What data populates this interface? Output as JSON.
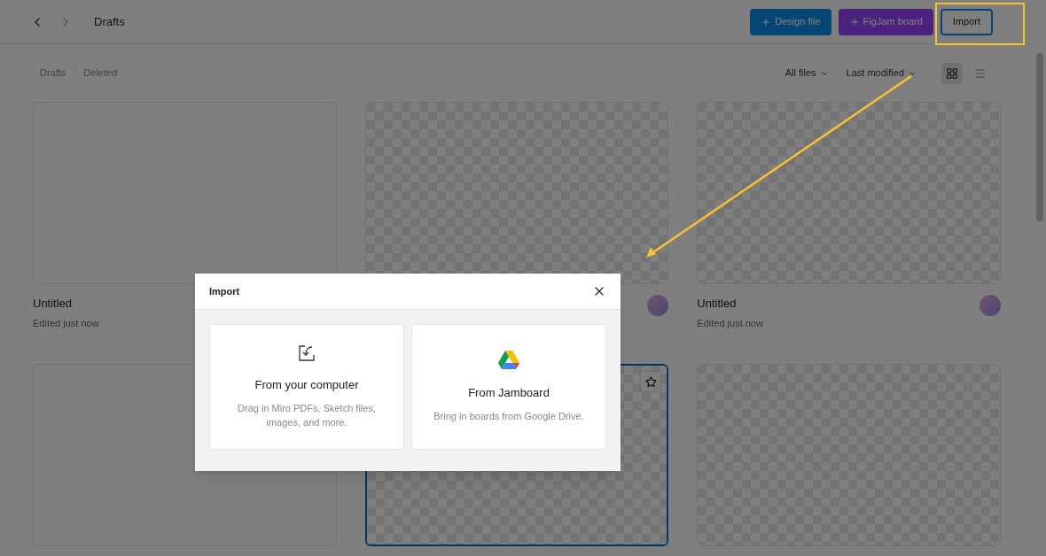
{
  "header": {
    "title": "Drafts",
    "buttons": [
      {
        "label": "Design file",
        "kind": "design"
      },
      {
        "label": "FigJam board",
        "kind": "figjam"
      },
      {
        "label": "Import",
        "kind": "outline"
      }
    ]
  },
  "tabs": [
    {
      "label": "Drafts"
    },
    {
      "label": "Deleted"
    }
  ],
  "filters": [
    "All files",
    "Last modified"
  ],
  "view": [
    {
      "kind": "grid",
      "selected": true
    },
    {
      "kind": "list",
      "selected": false
    }
  ],
  "files": [
    {
      "kind": "blank",
      "title": "Untitled",
      "subtitle": "Edited just now",
      "avatar": false,
      "selected": false
    },
    {
      "kind": "checker",
      "avatar": true,
      "selected": false
    },
    {
      "kind": "checker",
      "title": "Untitled",
      "subtitle": "Edited just now",
      "avatar": true,
      "selected": false
    },
    {
      "kind": "blank",
      "avatar": false,
      "selected": false
    },
    {
      "kind": "checker",
      "avatar": false,
      "selected": true
    },
    {
      "kind": "checker",
      "avatar": false,
      "selected": false
    }
  ],
  "dialog": {
    "title": "Import",
    "options": [
      {
        "kind": "computer",
        "title": "From your computer",
        "description": "Drag in Miro PDFs, Sketch files, images, and more."
      },
      {
        "kind": "drive",
        "title": "From Jamboard",
        "description": "Bring in boards from Google Drive."
      }
    ]
  }
}
